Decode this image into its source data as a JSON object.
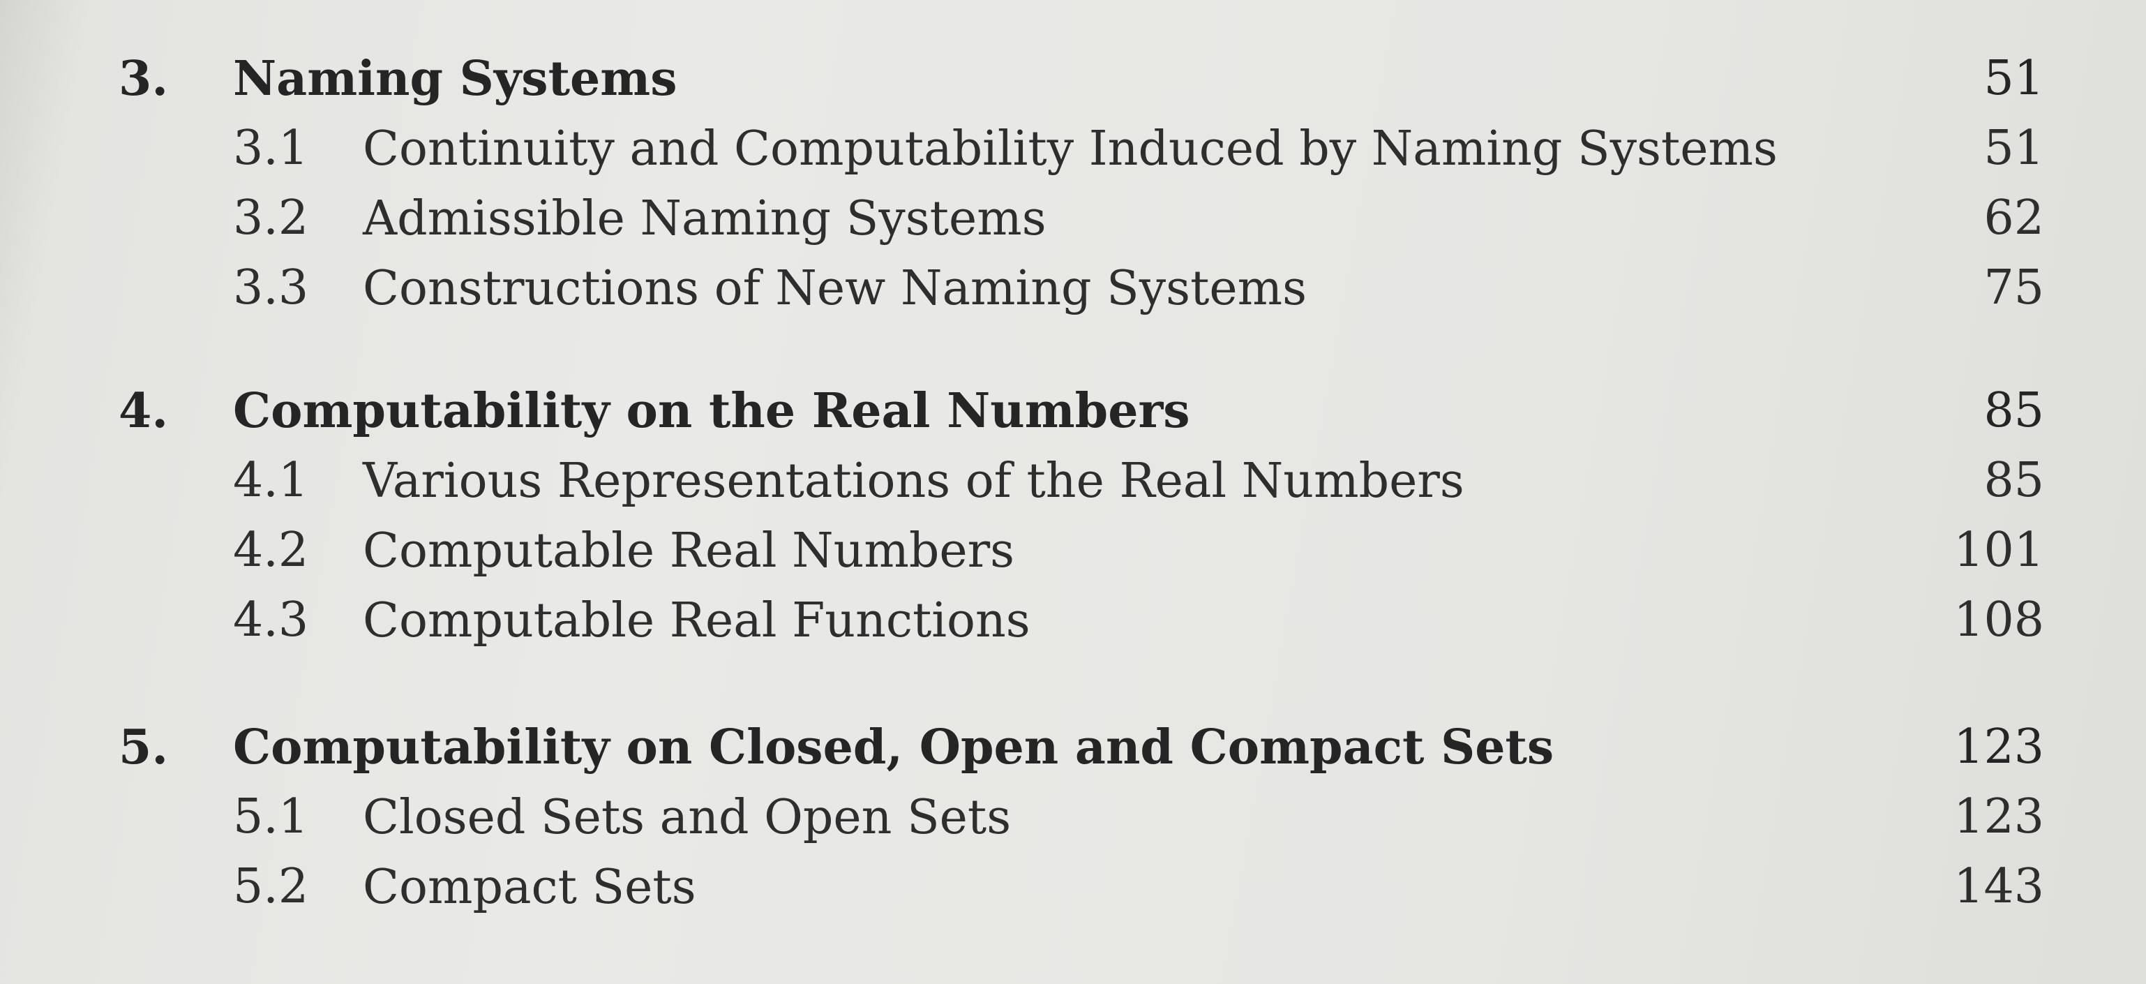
{
  "toc": [
    {
      "number": "3.",
      "title": "Naming Systems",
      "page": "51",
      "sections": [
        {
          "number": "3.1",
          "title": "Continuity and Computability Induced by Naming Systems",
          "page": "51"
        },
        {
          "number": "3.2",
          "title": "Admissible Naming Systems",
          "page": "62"
        },
        {
          "number": "3.3",
          "title": "Constructions of New Naming Systems",
          "page": "75"
        }
      ]
    },
    {
      "number": "4.",
      "title": "Computability on the Real Numbers",
      "page": "85",
      "sections": [
        {
          "number": "4.1",
          "title": "Various Representations of the Real Numbers",
          "page": "85"
        },
        {
          "number": "4.2",
          "title": "Computable Real Numbers",
          "page": "101"
        },
        {
          "number": "4.3",
          "title": "Computable Real Functions",
          "page": "108"
        }
      ]
    },
    {
      "number": "5.",
      "title": "Computability on Closed, Open and Compact Sets",
      "page": "123",
      "sections": [
        {
          "number": "5.1",
          "title": "Closed Sets and Open Sets",
          "page": "123"
        },
        {
          "number": "5.2",
          "title": "Compact Sets",
          "page": "143"
        }
      ]
    }
  ]
}
